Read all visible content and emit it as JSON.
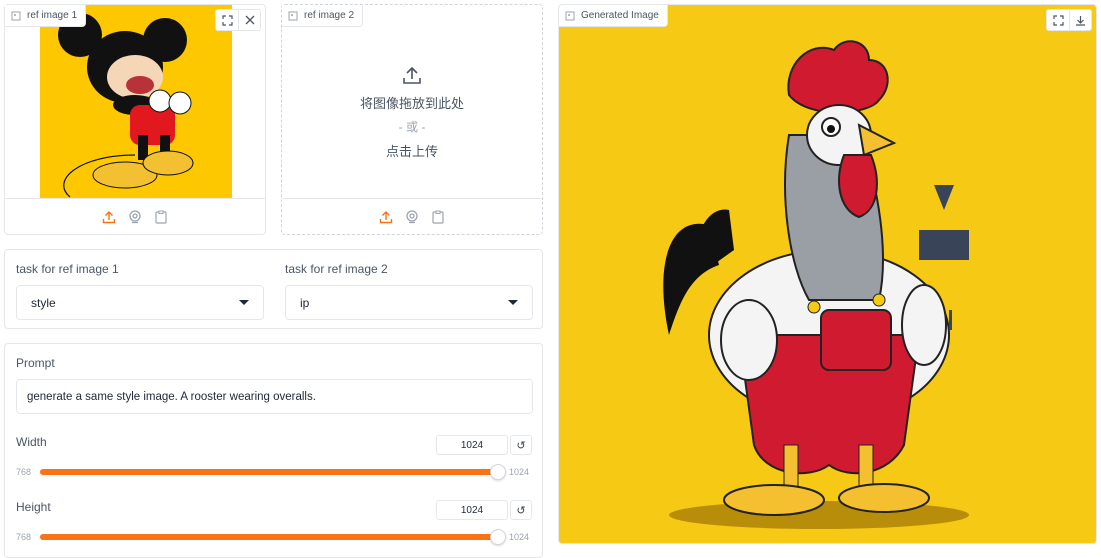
{
  "ref1": {
    "label": "ref image 1",
    "fullscreen_icon": "fullscreen-icon",
    "clear_icon": "close-icon"
  },
  "ref2": {
    "label": "ref image 2",
    "drop_text": "将图像拖放到此处",
    "or_text": "- 或 -",
    "click_text": "点击上传"
  },
  "tasks": {
    "task1_label": "task for ref image 1",
    "task1_value": "style",
    "task2_label": "task for ref image 2",
    "task2_value": "ip"
  },
  "prompt": {
    "label": "Prompt",
    "value": "generate a same style image. A rooster wearing overalls."
  },
  "width": {
    "label": "Width",
    "value": "1024",
    "min": "768",
    "max": "1024",
    "fraction": 1.0
  },
  "height": {
    "label": "Height",
    "value": "1024",
    "min": "768",
    "max": "1024",
    "fraction": 1.0
  },
  "output": {
    "label": "Generated Image"
  },
  "colors": {
    "accent": "#f97316",
    "yellow_bg": "#f6c915",
    "ref_bg": "#fdc800"
  }
}
